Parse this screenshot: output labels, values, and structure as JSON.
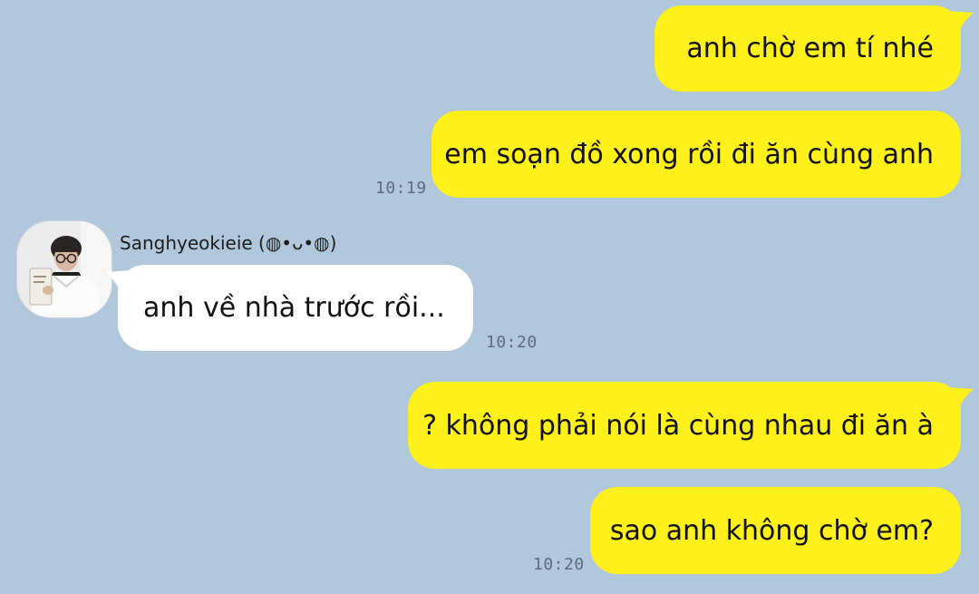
{
  "chat": {
    "colors": {
      "background": "#b0c7dc",
      "outgoing_bubble": "#fef01b",
      "incoming_bubble": "#ffffff",
      "timestamp": "#5a6d80"
    },
    "messages": [
      {
        "direction": "outgoing",
        "text": "anh chờ em tí nhé"
      },
      {
        "direction": "outgoing",
        "text": "em soạn đồ xong rồi đi ăn cùng anh",
        "time": "10:19"
      },
      {
        "direction": "incoming",
        "sender": "Sanghyeokieie (◍•ᴗ•◍)",
        "avatar_icon": "person-reading-avatar",
        "text": "anh về nhà trước rồi...",
        "time": "10:20"
      },
      {
        "direction": "outgoing",
        "text": "? không phải nói là cùng nhau đi ăn à"
      },
      {
        "direction": "outgoing",
        "text": "sao anh không chờ em?",
        "time": "10:20"
      }
    ]
  }
}
